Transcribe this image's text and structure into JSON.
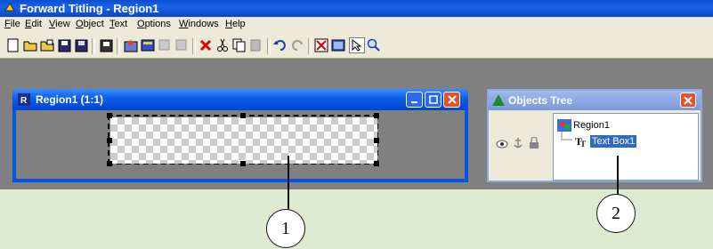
{
  "app": {
    "title": "Forward Titling - Region1"
  },
  "menu": [
    "File",
    "Edit",
    "View",
    "Object",
    "Text",
    "Options",
    "Windows",
    "Help"
  ],
  "menu_underline": [
    "F",
    "E",
    "V",
    "O",
    "T",
    "O",
    "W",
    "H"
  ],
  "toolbar": {
    "icons": [
      "new-icon",
      "open-icon",
      "open-template-icon",
      "save-icon",
      "save-all-icon",
      "save-region-icon",
      "effects-icon",
      "render-icon",
      "disabled-icon-1",
      "disabled-icon-2",
      "delete-icon",
      "cut-icon",
      "copy-icon",
      "paste-icon",
      "undo-icon",
      "redo-icon",
      "clear-icon",
      "preview-icon",
      "select-pointer-icon",
      "zoom-icon"
    ]
  },
  "region_window": {
    "title": "Region1  (1:1)"
  },
  "objects_tree": {
    "title": "Objects Tree",
    "root": "Region1",
    "child": "Text Box1"
  },
  "callouts": [
    "1",
    "2"
  ]
}
